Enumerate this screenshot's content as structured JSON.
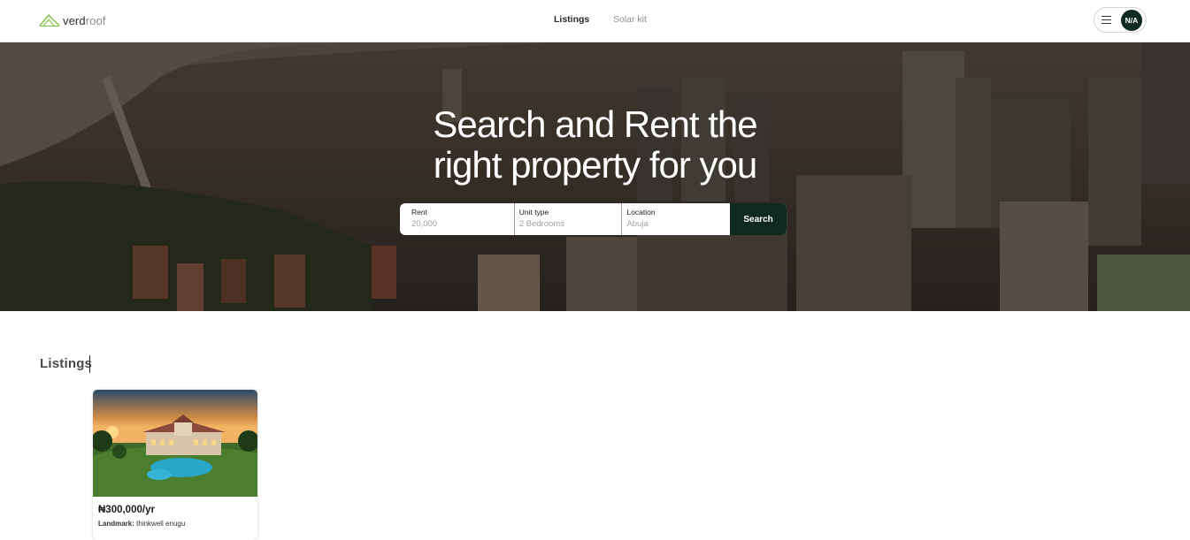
{
  "header": {
    "logo": {
      "part1": "verd",
      "part2": "roof"
    },
    "nav": [
      {
        "label": "Listings",
        "active": true
      },
      {
        "label": "Solar kit",
        "active": false
      }
    ],
    "user": {
      "initials": "N/A"
    }
  },
  "hero": {
    "title_line1": "Search and Rent the",
    "title_line2": "right property for you",
    "search": {
      "rent": {
        "label": "Rent",
        "placeholder": "20,000"
      },
      "unit_type": {
        "label": "Unit type",
        "placeholder": "2 Bedrooms"
      },
      "location": {
        "label": "Location",
        "placeholder": "Abuja"
      },
      "button_label": "Search"
    }
  },
  "listings": {
    "title": "Listings",
    "items": [
      {
        "price": "₦300,000/yr",
        "landmark_label": "Landmark:",
        "landmark_value": "thinkwell enugu"
      }
    ]
  },
  "colors": {
    "brand_dark": "#0e2a1e",
    "accent_green": "#7cc242"
  }
}
